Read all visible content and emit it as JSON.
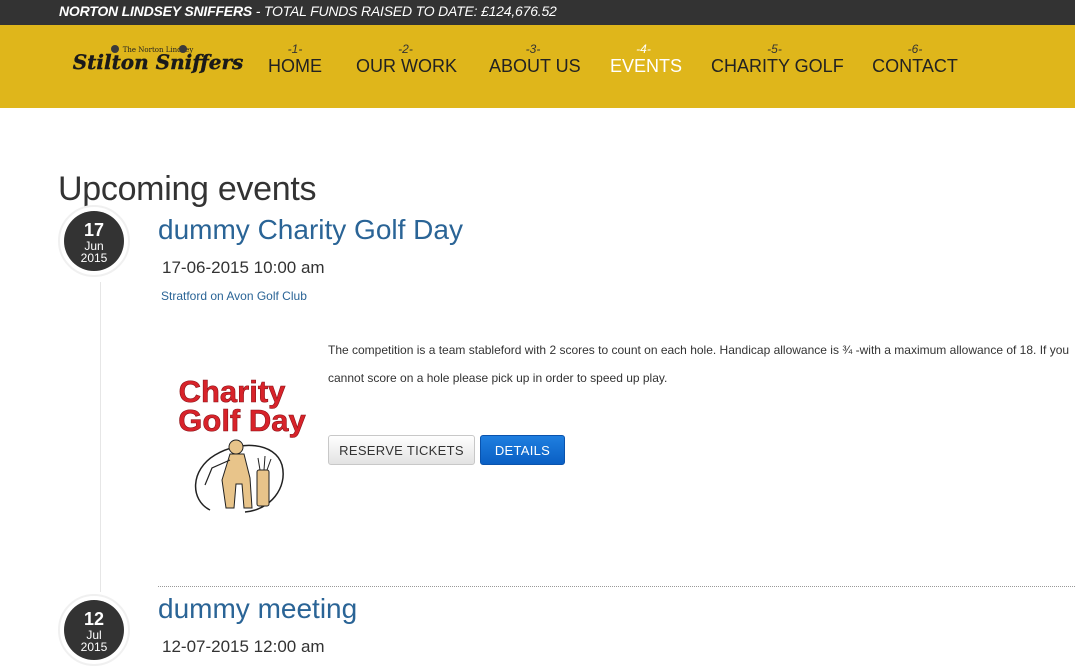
{
  "topbar": {
    "org_name": "NORTON LINDSEY SNIFFERS",
    "funds_text": " - TOTAL FUNDS RAISED TO DATE: £124,676.52"
  },
  "logo": {
    "text": "Stilton Sniffers",
    "subtext": "The Norton Lindsey"
  },
  "nav": {
    "items": [
      {
        "num": "-1-",
        "label": "HOME"
      },
      {
        "num": "-2-",
        "label": "OUR WORK"
      },
      {
        "num": "-3-",
        "label": "ABOUT US"
      },
      {
        "num": "-4-",
        "label": "EVENTS"
      },
      {
        "num": "-5-",
        "label": "CHARITY GOLF"
      },
      {
        "num": "-6-",
        "label": "CONTACT"
      }
    ],
    "active_label": "EVENTS"
  },
  "page": {
    "title": "Upcoming events"
  },
  "events": [
    {
      "day": "17",
      "month": "Jun",
      "year": "2015",
      "title": "dummy Charity Golf Day",
      "datetime": "17-06-2015 10:00 am",
      "venue": "Stratford on Avon Golf Club",
      "description": "The competition is a team stableford with 2 scores to count on each hole. Handicap allowance is ¾ -with a maximum allowance of 18. If you cannot score on a hole please pick up in order to speed up play.",
      "image_text_line1": "Charity",
      "image_text_line2": "Golf Day",
      "reserve_label": "RESERVE TICKETS",
      "details_label": "DETAILS"
    },
    {
      "day": "12",
      "month": "Jul",
      "year": "2015",
      "title": "dummy meeting",
      "datetime": "12-07-2015 12:00 am"
    }
  ],
  "colors": {
    "topbar": "#333333",
    "navbar": "#dfb61b",
    "link": "#2a6496",
    "primary_button": "#0a5fc4"
  }
}
